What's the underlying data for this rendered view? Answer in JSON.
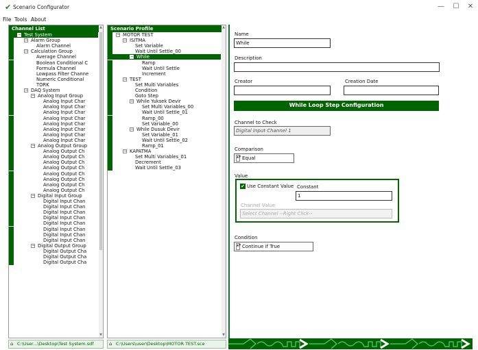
{
  "window": {
    "title": "Scenario Configurator",
    "logo_glyph": "✔",
    "minimize_glyph": "—",
    "maximize_glyph": "☐",
    "close_glyph": "✕"
  },
  "menu": {
    "items": [
      "File",
      "Tools",
      "About"
    ]
  },
  "channel_list": {
    "header": "Channel List",
    "path": "C:\\User...\\Desktop\\Test System.sdf",
    "path_icon": "⌂",
    "rows": [
      {
        "text": "Test System",
        "indent": 0,
        "expander": "−",
        "selected": true
      },
      {
        "text": "Alarm Group",
        "indent": 1,
        "expander": "−"
      },
      {
        "text": "Alarm Channel",
        "indent": 2
      },
      {
        "text": "Calculation Group",
        "indent": 1,
        "expander": "−"
      },
      {
        "text": "Average Channel",
        "indent": 2
      },
      {
        "text": "Boolean Conditional C",
        "indent": 2
      },
      {
        "text": "Formula Channel",
        "indent": 2
      },
      {
        "text": "Lowpass Filter Channe",
        "indent": 2
      },
      {
        "text": "Numeric Conditional",
        "indent": 2
      },
      {
        "text": "TORK",
        "indent": 2
      },
      {
        "text": "DAQ System",
        "indent": 1,
        "expander": "−"
      },
      {
        "text": "Analog Input Group",
        "indent": 2,
        "expander": "−"
      },
      {
        "text": "Analog Input Char",
        "indent": 3
      },
      {
        "text": "Analog Input Char",
        "indent": 3
      },
      {
        "text": "Analog Input Char",
        "indent": 3
      },
      {
        "text": "Analog Input Char",
        "indent": 3
      },
      {
        "text": "Analog Input Char",
        "indent": 3
      },
      {
        "text": "Analog Input Char",
        "indent": 3
      },
      {
        "text": "Analog Input Char",
        "indent": 3
      },
      {
        "text": "Analog Input Char",
        "indent": 3
      },
      {
        "text": "Analog Output Group",
        "indent": 2,
        "expander": "−"
      },
      {
        "text": "Analog Output Ch",
        "indent": 3
      },
      {
        "text": "Analog Output Ch",
        "indent": 3
      },
      {
        "text": "Analog Output Ch",
        "indent": 3
      },
      {
        "text": "Analog Output Ch",
        "indent": 3
      },
      {
        "text": "Analog Output Ch",
        "indent": 3
      },
      {
        "text": "Analog Output Ch",
        "indent": 3
      },
      {
        "text": "Analog Output Ch",
        "indent": 3
      },
      {
        "text": "Analog Output Ch",
        "indent": 3
      },
      {
        "text": "Digital Input Group",
        "indent": 2,
        "expander": "−"
      },
      {
        "text": "Digital Input Chan",
        "indent": 3
      },
      {
        "text": "Digital Input Chan",
        "indent": 3
      },
      {
        "text": "Digital Input Chan",
        "indent": 3
      },
      {
        "text": "Digital Input Chan",
        "indent": 3
      },
      {
        "text": "Digital Input Chan",
        "indent": 3
      },
      {
        "text": "Digital Input Chan",
        "indent": 3
      },
      {
        "text": "Digital Input Chan",
        "indent": 3
      },
      {
        "text": "Digital Input Chan",
        "indent": 3
      },
      {
        "text": "Digital Output Group",
        "indent": 2,
        "expander": "−"
      },
      {
        "text": "Digital Output Cha",
        "indent": 3
      },
      {
        "text": "Digital Output Cha",
        "indent": 3
      },
      {
        "text": "Digital Output Cha",
        "indent": 3
      }
    ]
  },
  "scenario_profile": {
    "header": "Scenario Profile",
    "path": "C:\\Users\\user\\Desktop\\MOTOR TEST.sce",
    "path_icon": "⌂",
    "rows": [
      {
        "text": "MOTOR TEST",
        "indent": 0,
        "expander": "−"
      },
      {
        "text": "ISITMA",
        "indent": 1,
        "expander": "−"
      },
      {
        "text": "Set Variable",
        "indent": 2
      },
      {
        "text": "Wait Until Settle_00",
        "indent": 2
      },
      {
        "text": "While",
        "indent": 2,
        "expander": "−",
        "selected": true
      },
      {
        "text": "Ramp",
        "indent": 3
      },
      {
        "text": "Wait Until Settle",
        "indent": 3
      },
      {
        "text": "Increment",
        "indent": 3
      },
      {
        "text": "TEST",
        "indent": 1,
        "expander": "−"
      },
      {
        "text": "Set Multi Variables",
        "indent": 2
      },
      {
        "text": "Condition",
        "indent": 2
      },
      {
        "text": "Goto Step",
        "indent": 2
      },
      {
        "text": "While Yuksek Devir",
        "indent": 2,
        "expander": "−"
      },
      {
        "text": "Set Multi Variables_00",
        "indent": 3
      },
      {
        "text": "Wait Until Settle_01",
        "indent": 3
      },
      {
        "text": "Ramp_00",
        "indent": 3
      },
      {
        "text": "Set Variable_00",
        "indent": 3
      },
      {
        "text": "While Dusuk Devir",
        "indent": 2,
        "expander": "−"
      },
      {
        "text": "Set Variable_01",
        "indent": 3
      },
      {
        "text": "Wait Until Settle_02",
        "indent": 3
      },
      {
        "text": "Ramp_01",
        "indent": 3
      },
      {
        "text": "KAPATMA",
        "indent": 1,
        "expander": "−"
      },
      {
        "text": "Set Multi Variables_01",
        "indent": 2
      },
      {
        "text": "Decrement",
        "indent": 2
      },
      {
        "text": "Wait Until Settle_03",
        "indent": 2
      }
    ]
  },
  "form": {
    "name_label": "Name",
    "name_value": "While",
    "description_label": "Description",
    "description_value": "",
    "creator_label": "Creator",
    "creator_value": "",
    "creation_date_label": "Creation Date",
    "creation_date_value": "",
    "banner": "While Loop Step Configuration",
    "channel_label": "Channel to Check",
    "channel_value": "Digital Input Channel 1",
    "comparison_label": "Comparison",
    "comparison_value": "Equal",
    "value_group_label": "Value",
    "use_constant_label": "Use Constant Value",
    "use_constant_checked": true,
    "constant_label": "Constant",
    "constant_value": "1",
    "channel_value_label": "Channel Value",
    "channel_value_placeholder": "Select Channel --Right Click--",
    "condition_label": "Condition",
    "condition_value": "Continue if True",
    "spin_glyph": "▲▼",
    "check_glyph": "✔"
  },
  "colors": {
    "accent": "#006400",
    "status_wave": "#4fd07a"
  }
}
